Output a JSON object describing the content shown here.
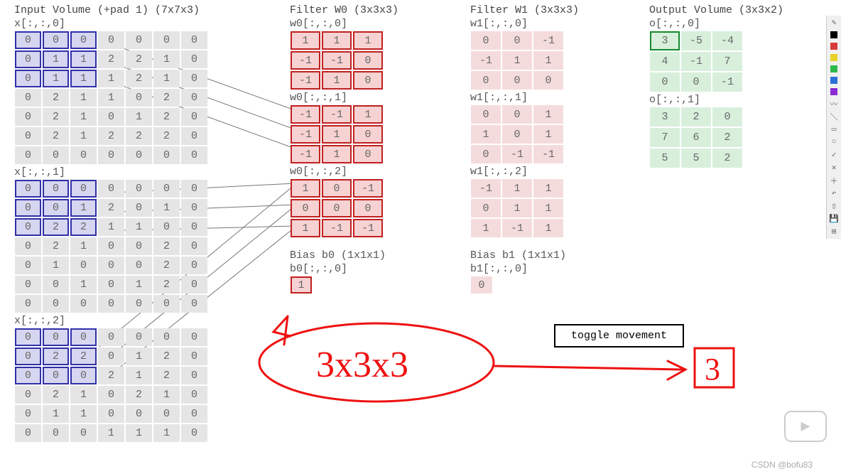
{
  "headers": {
    "input": "Input Volume (+pad 1) (7x7x3)",
    "w0": "Filter W0 (3x3x3)",
    "w1": "Filter W1 (3x3x3)",
    "out": "Output Volume (3x3x2)"
  },
  "labels": {
    "x0": "x[:,:,0]",
    "x1": "x[:,:,1]",
    "x2": "x[:,:,2]",
    "w00": "w0[:,:,0]",
    "w01": "w0[:,:,1]",
    "w02": "w0[:,:,2]",
    "w10": "w1[:,:,0]",
    "w11": "w1[:,:,1]",
    "w12": "w1[:,:,2]",
    "b0h": "Bias b0 (1x1x1)",
    "b0": "b0[:,:,0]",
    "b1h": "Bias b1 (1x1x1)",
    "b1": "b1[:,:,0]",
    "o0": "o[:,:,0]",
    "o1": "o[:,:,1]",
    "toggle": "toggle movement",
    "watermark": "CSDN @bofu83"
  },
  "input": {
    "x0": [
      [
        "0",
        "0",
        "0",
        "0",
        "0",
        "0",
        "0"
      ],
      [
        "0",
        "1",
        "1",
        "2",
        "2",
        "1",
        "0"
      ],
      [
        "0",
        "1",
        "1",
        "1",
        "2",
        "1",
        "0"
      ],
      [
        "0",
        "2",
        "1",
        "1",
        "0",
        "2",
        "0"
      ],
      [
        "0",
        "2",
        "1",
        "0",
        "1",
        "2",
        "0"
      ],
      [
        "0",
        "2",
        "1",
        "2",
        "2",
        "2",
        "0"
      ],
      [
        "0",
        "0",
        "0",
        "0",
        "0",
        "0",
        "0"
      ]
    ],
    "x1": [
      [
        "0",
        "0",
        "0",
        "0",
        "0",
        "0",
        "0"
      ],
      [
        "0",
        "0",
        "1",
        "2",
        "0",
        "1",
        "0"
      ],
      [
        "0",
        "2",
        "2",
        "1",
        "1",
        "0",
        "0"
      ],
      [
        "0",
        "2",
        "1",
        "0",
        "0",
        "2",
        "0"
      ],
      [
        "0",
        "1",
        "0",
        "0",
        "0",
        "2",
        "0"
      ],
      [
        "0",
        "0",
        "1",
        "0",
        "1",
        "2",
        "0"
      ],
      [
        "0",
        "0",
        "0",
        "0",
        "0",
        "0",
        "0"
      ]
    ],
    "x2": [
      [
        "0",
        "0",
        "0",
        "0",
        "0",
        "0",
        "0"
      ],
      [
        "0",
        "2",
        "2",
        "0",
        "1",
        "2",
        "0"
      ],
      [
        "0",
        "0",
        "0",
        "2",
        "1",
        "2",
        "0"
      ],
      [
        "0",
        "2",
        "1",
        "0",
        "2",
        "1",
        "0"
      ],
      [
        "0",
        "1",
        "1",
        "0",
        "0",
        "0",
        "0"
      ],
      [
        "0",
        "0",
        "0",
        "1",
        "1",
        "1",
        "0"
      ],
      ""
    ]
  },
  "input_hl": {
    "rows": [
      0,
      1,
      2
    ],
    "cols": [
      0,
      1,
      2
    ]
  },
  "w0": {
    "d0": [
      [
        "1",
        "1",
        "1"
      ],
      [
        "-1",
        "-1",
        "0"
      ],
      [
        "-1",
        "1",
        "0"
      ]
    ],
    "d1": [
      [
        "-1",
        "-1",
        "1"
      ],
      [
        "-1",
        "1",
        "0"
      ],
      [
        "-1",
        "1",
        "0"
      ]
    ],
    "d2": [
      [
        "1",
        "0",
        "-1"
      ],
      [
        "0",
        "0",
        "0"
      ],
      [
        "1",
        "-1",
        "-1"
      ]
    ]
  },
  "w1": {
    "d0": [
      [
        "0",
        "0",
        "-1"
      ],
      [
        "-1",
        "1",
        "1"
      ],
      [
        "0",
        "0",
        "0"
      ]
    ],
    "d1": [
      [
        "0",
        "0",
        "1"
      ],
      [
        "1",
        "0",
        "1"
      ],
      [
        "0",
        "-1",
        "-1"
      ]
    ],
    "d2": [
      [
        "-1",
        "1",
        "1"
      ],
      [
        "0",
        "1",
        "1"
      ],
      [
        "1",
        "-1",
        "1"
      ]
    ]
  },
  "bias": {
    "b0": "1",
    "b1": "0"
  },
  "out": {
    "o0": [
      [
        "3",
        "-5",
        "-4"
      ],
      [
        "4",
        "-1",
        "7"
      ],
      [
        "0",
        "0",
        "-1"
      ]
    ],
    "o1": [
      [
        "3",
        "2",
        "0"
      ],
      [
        "7",
        "6",
        "2"
      ],
      [
        "5",
        "5",
        "2"
      ]
    ]
  },
  "out_hl": {
    "slice": "o0",
    "r": 0,
    "c": 0
  },
  "annotation": {
    "text": "3x3x3",
    "result": "3"
  },
  "toolbar": {
    "colors": [
      "#000000",
      "#d83a3a",
      "#e8d22a",
      "#2eb84d",
      "#2b6fd6",
      "#8a2bd6"
    ]
  }
}
